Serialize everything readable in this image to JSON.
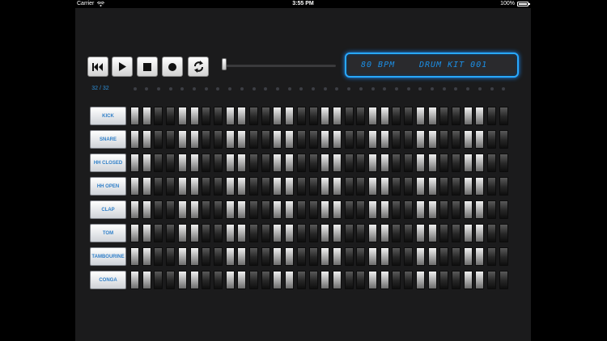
{
  "status_bar": {
    "carrier": "Carrier",
    "time": "3:55 PM",
    "battery": "100%"
  },
  "transport": {
    "rewind": "rewind-icon",
    "play": "play-icon",
    "stop": "stop-icon",
    "record": "record-icon",
    "loop": "loop-icon"
  },
  "tempo_slider": {
    "position": 0.0
  },
  "display": {
    "bpm": "80 BPM",
    "kit": "DRUM KIT 001"
  },
  "step_counter": "32 / 32",
  "steps_count": 32,
  "instruments": [
    "KICK",
    "SNARE",
    "HH CLOSED",
    "HH OPEN",
    "CLAP",
    "TOM",
    "TAMBOURINE",
    "CONGA"
  ],
  "colors": {
    "accent": "#28a8ff",
    "label_text": "#2f7fc8",
    "background": "#1b1b1c"
  }
}
